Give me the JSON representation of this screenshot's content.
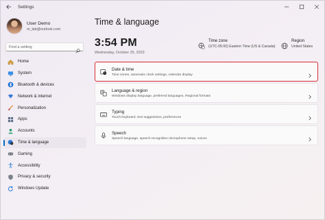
{
  "window": {
    "title": "Settings"
  },
  "profile": {
    "name": "User Demo",
    "email": "m_lab@outlook.com"
  },
  "search": {
    "placeholder": "Find a setting"
  },
  "sidebar": {
    "items": [
      {
        "label": "Home",
        "icon": "home-icon",
        "active": false
      },
      {
        "label": "System",
        "icon": "system-icon",
        "active": false
      },
      {
        "label": "Bluetooth & devices",
        "icon": "bluetooth-icon",
        "active": false
      },
      {
        "label": "Network & internet",
        "icon": "network-icon",
        "active": false
      },
      {
        "label": "Personalization",
        "icon": "brush-icon",
        "active": false
      },
      {
        "label": "Apps",
        "icon": "apps-icon",
        "active": false
      },
      {
        "label": "Accounts",
        "icon": "accounts-icon",
        "active": false
      },
      {
        "label": "Time & language",
        "icon": "globe-clock-icon",
        "active": true
      },
      {
        "label": "Gaming",
        "icon": "gaming-icon",
        "active": false
      },
      {
        "label": "Accessibility",
        "icon": "accessibility-icon",
        "active": false
      },
      {
        "label": "Privacy & security",
        "icon": "shield-icon",
        "active": false
      },
      {
        "label": "Windows Update",
        "icon": "update-icon",
        "active": false
      }
    ]
  },
  "main": {
    "title": "Time & language",
    "clock": "3:54 PM",
    "date": "Wednesday, October 25, 2023",
    "timezone": {
      "label": "Time zone",
      "value": "(UTC-05:00) Eastern Time (US & Canada)"
    },
    "region": {
      "label": "Region",
      "value": "United States"
    },
    "cards": [
      {
        "title": "Date & time",
        "subtitle": "Time zones, automatic clock settings, calendar display",
        "icon": "clock-icon",
        "highlighted": true
      },
      {
        "title": "Language & region",
        "subtitle": "Windows display language, preferred languages, Regional formats",
        "icon": "language-icon",
        "highlighted": false
      },
      {
        "title": "Typing",
        "subtitle": "Touch keyboard, text suggestions, preferences",
        "icon": "keyboard-icon",
        "highlighted": false
      },
      {
        "title": "Speech",
        "subtitle": "Speech language, speech recognition microphone setup, voices",
        "icon": "microphone-icon",
        "highlighted": false
      }
    ]
  },
  "colors": {
    "accent": "#0067c0",
    "highlight_border": "#d42a33"
  }
}
